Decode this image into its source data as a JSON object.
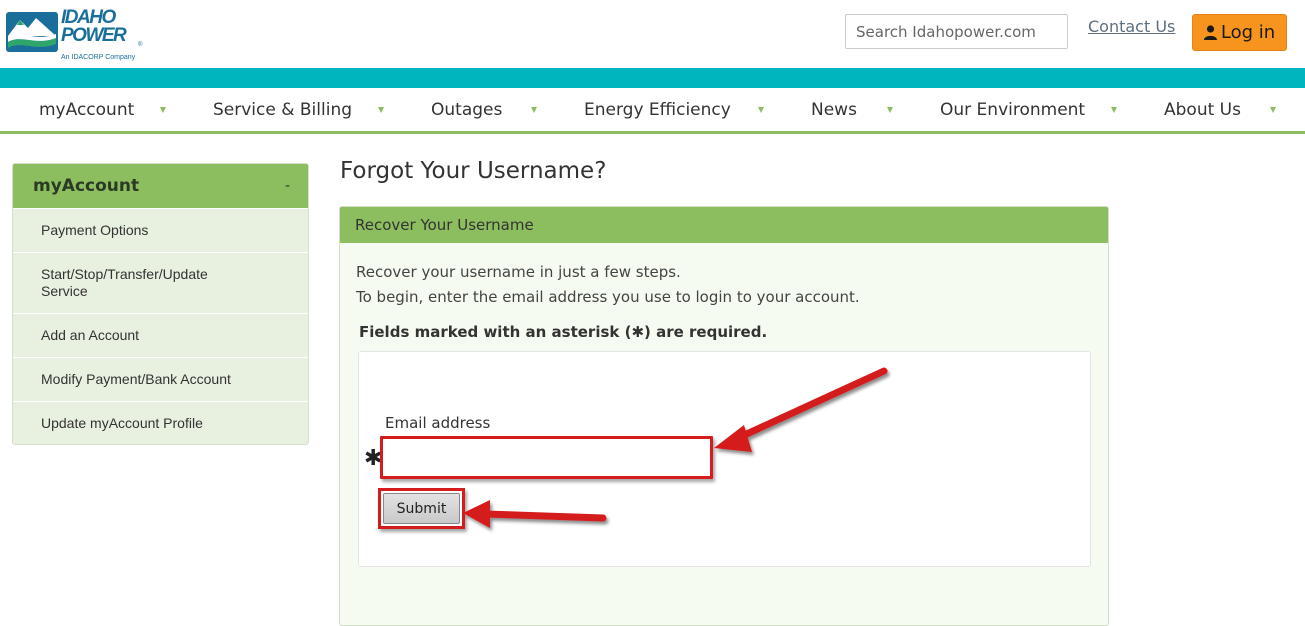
{
  "brand": {
    "logo_word_line1": "IDAHO",
    "logo_word_line2": "POWER",
    "logo_registered": "®",
    "logo_tagline": "An IDACORP Company",
    "logo_color": "#1a6e9a",
    "logo_accent": "#2da56b"
  },
  "header": {
    "search_placeholder": "Search Idahopower.com",
    "contact_label": "Contact Us",
    "login_label": "Log in",
    "login_color": "#f7941d",
    "accent_bar_color": "#00b5bd"
  },
  "nav": {
    "items": [
      {
        "label": "myAccount"
      },
      {
        "label": "Service & Billing"
      },
      {
        "label": "Outages"
      },
      {
        "label": "Energy Efficiency"
      },
      {
        "label": "News"
      },
      {
        "label": "Our Environment"
      },
      {
        "label": "About Us"
      }
    ],
    "accent_color": "#8cbd5e"
  },
  "sidebar": {
    "title": "myAccount",
    "toggle": "-",
    "items": [
      {
        "label": "Payment Options"
      },
      {
        "label": "Start/Stop/Transfer/Update Service"
      },
      {
        "label": "Add an Account"
      },
      {
        "label": "Modify Payment/Bank Account"
      },
      {
        "label": "Update myAccount Profile"
      }
    ]
  },
  "main": {
    "page_title": "Forgot Your Username?",
    "panel_title": "Recover Your Username",
    "intro_line1": "Recover your username in just a few steps.",
    "intro_line2": "To begin, enter the email address you use to login to your account.",
    "required_note": "Fields marked with an asterisk (✱) are required.",
    "form": {
      "email_label": "Email address",
      "email_value": "",
      "asterisk": "✱",
      "submit_label": "Submit"
    }
  },
  "annotations": {
    "arrow_color": "#d41c1c"
  }
}
